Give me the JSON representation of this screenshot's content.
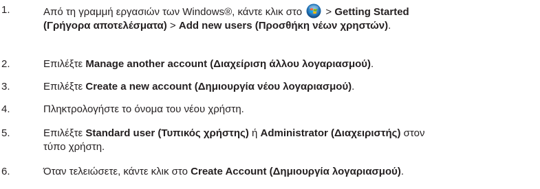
{
  "steps": [
    {
      "number": "1.",
      "line1": {
        "t1": "Από τη γραμμή εργασιών των Windows®, κάντε κλικ στο ",
        "icon": "windows-start-orb-icon",
        "t2": " > ",
        "b1": "Getting Started"
      },
      "line2": {
        "b1": "(Γρήγορα αποτελέσματα)",
        "t1": " > ",
        "b2": "Add new users (Προσθήκη νέων χρηστών)",
        "t2": "."
      }
    },
    {
      "number": "2.",
      "t1": "Επιλέξτε ",
      "b1": "Manage another account (Διαχείριση άλλου λογαριασμού)",
      "t2": "."
    },
    {
      "number": "3.",
      "t1": "Επιλέξτε ",
      "b1": "Create a new account (Δημιουργία νέου λογαριασμού)",
      "t2": "."
    },
    {
      "number": "4.",
      "t1": "Πληκτρολογήστε το όνομα του νέου χρήστη."
    },
    {
      "number": "5.",
      "line1": {
        "t1": "Επιλέξτε ",
        "b1": "Standard user (Τυπικός χρήστης)",
        "t2": " ή ",
        "b2": "Administrator (Διαχειριστής)",
        "t3": " στον"
      },
      "line2": {
        "t1": "τύπο χρήστη."
      }
    },
    {
      "number": "6.",
      "t1": "Όταν τελειώσετε, κάντε κλικ στο ",
      "b1": "Create Account (Δημιουργία λογαριασμού)",
      "t2": "."
    }
  ]
}
